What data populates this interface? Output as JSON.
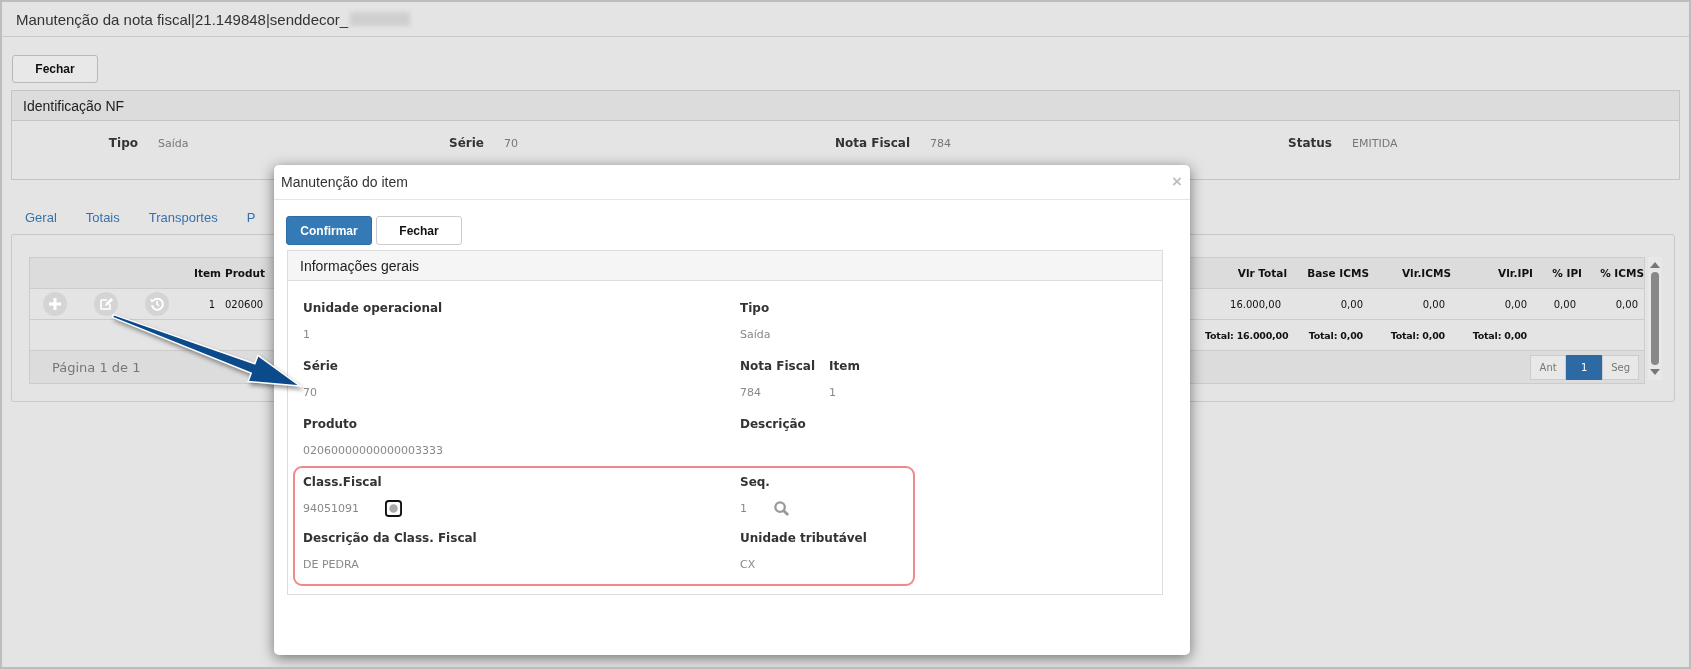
{
  "window": {
    "title": "Manutenção da nota fiscal|21.149848|senddecor_"
  },
  "toolbar": {
    "close_button": "Fechar"
  },
  "identification": {
    "title": "Identificação NF",
    "fields": [
      {
        "label": "Tipo",
        "value": "Saída"
      },
      {
        "label": "Série",
        "value": "70"
      },
      {
        "label": "Nota Fiscal",
        "value": "784"
      },
      {
        "label": "Status",
        "value": "EMITIDA"
      }
    ]
  },
  "tabs": [
    "Geral",
    "Totais",
    "Transportes",
    "P"
  ],
  "items_table": {
    "columns_left": [
      "Item",
      "Produt"
    ],
    "columns_right": [
      "Vlr Total",
      "Base ICMS",
      "Vlr.ICMS",
      "Vlr.IPI",
      "% IPI",
      "% ICMS"
    ],
    "rows": [
      {
        "item": "1",
        "product": "020600",
        "values": [
          "16.000,00",
          "0,00",
          "0,00",
          "0,00",
          "0,00",
          "0,00"
        ]
      }
    ],
    "totals": [
      "Total: 16.000,00",
      "Total: 0,00",
      "Total: 0,00",
      "Total: 0,00"
    ],
    "pager": {
      "info": "Página 1 de 1",
      "buttons": [
        {
          "label": "Ant",
          "selected": false
        },
        {
          "label": "1",
          "selected": true
        },
        {
          "label": "Seg",
          "selected": false
        }
      ]
    }
  },
  "item_dialog": {
    "title": "Manutenção do item",
    "close_glyph": "×",
    "buttons": [
      {
        "label": "Confirmar",
        "kind": "primary"
      },
      {
        "label": "Fechar",
        "kind": "default"
      }
    ],
    "panel_title": "Informações gerais",
    "groups": [
      {
        "highlighted": false,
        "rows": [
          {
            "left": [
              {
                "label": "Unidade operacional",
                "value": "1",
                "kind": "text"
              }
            ],
            "right": [
              {
                "label": "Tipo",
                "value": "Saída",
                "kind": "text"
              }
            ]
          },
          {
            "left": [
              {
                "label": "Série",
                "value": "70",
                "kind": "text"
              }
            ],
            "right": [
              {
                "label": "Nota Fiscal",
                "value": "784",
                "kind": "text"
              },
              {
                "label": "Item",
                "value": "1",
                "kind": "text"
              }
            ]
          },
          {
            "left": [
              {
                "label": "Produto",
                "value": "02060000000000003333",
                "kind": "text"
              }
            ],
            "right": [
              {
                "label": "Descrição",
                "kind": "text"
              }
            ]
          }
        ]
      },
      {
        "highlighted": true,
        "rows": [
          {
            "left": [
              {
                "label": "Class.Fiscal",
                "value": "94051091",
                "kind": "lookup",
                "focused": true
              }
            ],
            "right": [
              {
                "label": "Seq.",
                "value": "1",
                "kind": "lookup",
                "focused": false
              }
            ]
          },
          {
            "left": [
              {
                "label": "Descrição da Class. Fiscal",
                "value": "DE PEDRA",
                "kind": "text"
              }
            ],
            "right": [
              {
                "label": "Unidade tributável",
                "value": "CX",
                "kind": "text"
              }
            ]
          }
        ]
      }
    ]
  }
}
